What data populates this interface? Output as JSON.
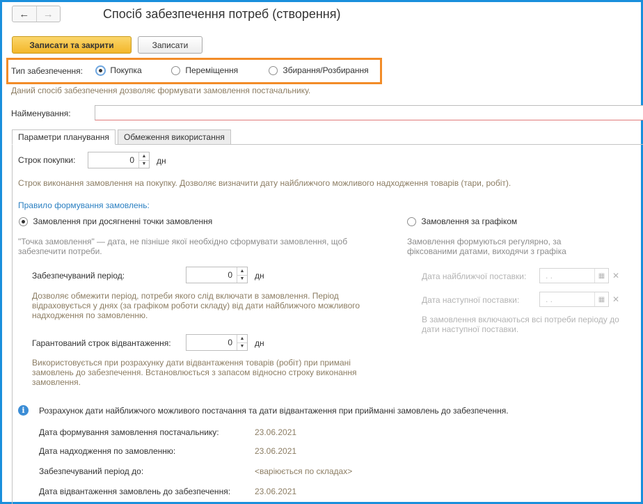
{
  "header": {
    "title": "Спосіб забезпечення потреб (створення)",
    "back_icon": "←",
    "forward_icon": "→"
  },
  "toolbar": {
    "save_close_label": "Записати та закрити",
    "save_label": "Записати"
  },
  "supply_type": {
    "label": "Тип забезпечення:",
    "options": [
      "Покупка",
      "Переміщення",
      "Збирання/Розбирання"
    ],
    "selected": "Покупка",
    "hint": "Даний спосіб забезпечення дозволяє формувати замовлення постачальнику."
  },
  "name_field": {
    "label": "Найменування:",
    "value": ""
  },
  "tabs": [
    {
      "label": "Параметри планування",
      "active": true
    },
    {
      "label": "Обмеження використання",
      "active": false
    }
  ],
  "planning": {
    "purchase_term": {
      "label": "Строк покупки:",
      "value": "0",
      "unit": "дн"
    },
    "purchase_term_hint": "Строк виконання замовлення на покупку. Дозволяє визначити дату найближчого можливого надходження товарів (тари, робіт).",
    "order_rule_title": "Правило формування замовлень:",
    "rule_reorder_point": {
      "label": "Замовлення при досягненні точки замовлення",
      "selected": true,
      "hint": "\"Точка замовлення\" — дата, не пізніше якої необхідно сформувати замовлення, щоб забезпечити потреби."
    },
    "rule_schedule": {
      "label": "Замовлення за графіком",
      "selected": false,
      "hint": "Замовлення формуються регулярно, за фіксованими датами, виходячи з графіка надходжень."
    },
    "covered_period": {
      "label": "Забезпечуваний період:",
      "value": "0",
      "unit": "дн"
    },
    "covered_period_hint": "Дозволяє обмежити період, потреби якого слід включати в замовлення. Період відраховується у днях (за графіком роботи складу) від дати найближчого можливого надходження по замовленню.",
    "guaranteed_term": {
      "label": "Гарантований строк відвантаження:",
      "value": "0",
      "unit": "дн"
    },
    "guaranteed_term_hint": "Використовується при розрахунку дати відвантаження товарів (робіт) при примані замовлень до забезпечення. Встановлюється з запасом відносно строку виконання замовлення.",
    "nearest_delivery": {
      "label": "Дата найближчої поставки:",
      "value": ". ."
    },
    "next_delivery": {
      "label": "Дата наступної поставки:",
      "value": ". ."
    },
    "schedule_hint": "В замовлення включаються всі потреби періоду до дати наступної поставки."
  },
  "calculation": {
    "title": "Розрахунок дати найближчого можливого постачання та дати відвантаження при прийманні замовлень до забезпечення.",
    "rows": [
      {
        "label": "Дата формування замовлення постачальнику:",
        "value": "23.06.2021"
      },
      {
        "label": "Дата надходження по замовленню:",
        "value": "23.06.2021"
      },
      {
        "label": "Забезпечуваний період до:",
        "value": "<варіюється по складах>"
      },
      {
        "label": "Дата відвантаження замовлень до забезпечення:",
        "value": "23.06.2021"
      }
    ]
  },
  "colors": {
    "frame": "#1a8fdc",
    "highlight": "#f28c28",
    "primary_button": "#f3b62a",
    "accent_blue": "#2a7fc1"
  }
}
